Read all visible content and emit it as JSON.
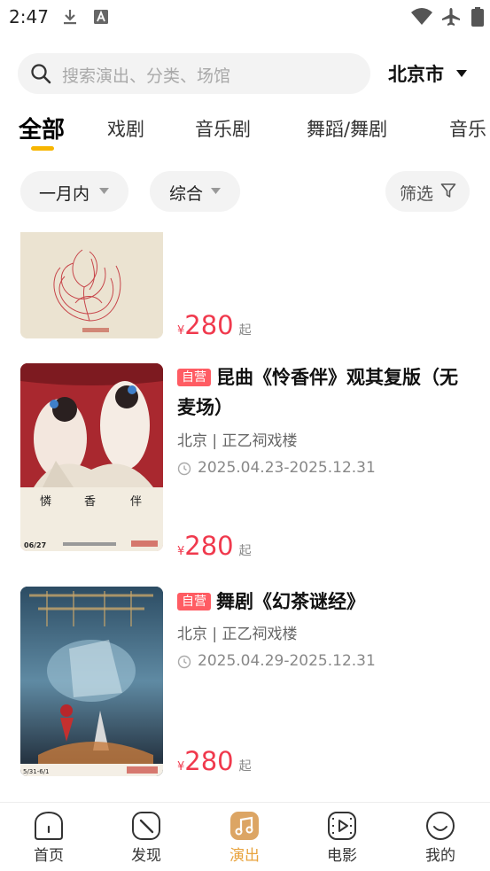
{
  "status_bar": {
    "time": "2:47"
  },
  "search": {
    "placeholder": "搜索演出、分类、场馆"
  },
  "city": {
    "label": "北京市"
  },
  "tabs": [
    {
      "label": "全部"
    },
    {
      "label": "戏剧"
    },
    {
      "label": "音乐剧"
    },
    {
      "label": "舞蹈/舞剧"
    },
    {
      "label": "音乐"
    }
  ],
  "filters": {
    "time": "一月内",
    "sort": "综合",
    "filter": "筛选"
  },
  "shows": [
    {
      "price_symbol": "¥",
      "price": "280",
      "price_suffix": "起"
    },
    {
      "badge": "自营",
      "title": "昆曲《怜香伴》观其复版（无麦场）",
      "venue": "北京 | 正乙祠戏楼",
      "dates": "2025.04.23-2025.12.31",
      "price_symbol": "¥",
      "price": "280",
      "price_suffix": "起",
      "poster_text": {
        "chars": [
          "憐",
          "香",
          "伴"
        ],
        "date": "06/27"
      }
    },
    {
      "badge": "自营",
      "title": "舞剧《幻茶谜经》",
      "venue": "北京 | 正乙祠戏楼",
      "dates": "2025.04.29-2025.12.31",
      "price_symbol": "¥",
      "price": "280",
      "price_suffix": "起",
      "poster_text": {
        "date": "5/31-6/1"
      }
    }
  ],
  "bottom_nav": [
    {
      "label": "首页",
      "icon": "home-icon"
    },
    {
      "label": "发现",
      "icon": "compass-icon"
    },
    {
      "label": "演出",
      "icon": "music-note-icon",
      "active": true
    },
    {
      "label": "电影",
      "icon": "film-icon"
    },
    {
      "label": "我的",
      "icon": "smile-icon"
    }
  ],
  "colors": {
    "accent": "#f7b500",
    "price": "#f0394d",
    "badge": "#ff5c63",
    "nav_active": "#e8a33d"
  }
}
